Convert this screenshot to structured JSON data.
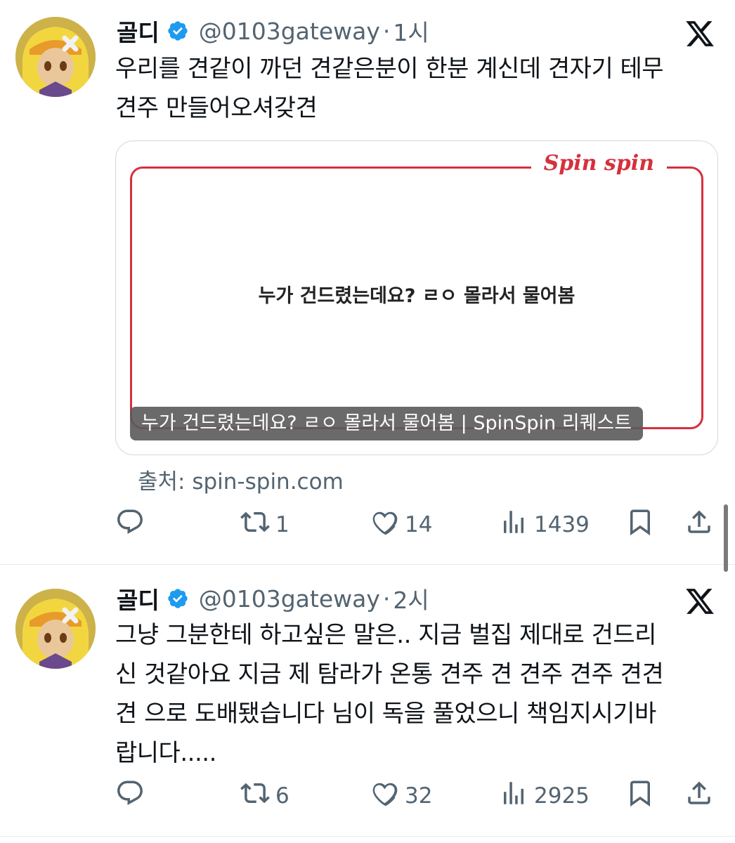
{
  "tweets": [
    {
      "name": "골디",
      "handle": "@0103gateway",
      "separator": "·",
      "time": "1시",
      "text": "우리를 견같이 까던 견같은분이 한분 계신데 견자기 테무\n견주 만들어오셔갖견",
      "card": {
        "brand": "Spin spin",
        "center_text": "누가 건드렸는데요? ㄹㅇ 몰라서 물어봄",
        "caption": "누가 건드렸는데요? ㄹㅇ 몰라서 물어봄 | SpinSpin 리퀘스트"
      },
      "source": "출처: spin-spin.com",
      "actions": {
        "reply": "",
        "retweet": "1",
        "like": "14",
        "views": "1439"
      }
    },
    {
      "name": "골디",
      "handle": "@0103gateway",
      "separator": "·",
      "time": "2시",
      "text": "그냥 그분한테 하고싶은 말은.. 지금 벌집 제대로 건드리\n신 것같아요 지금 제 탐라가 온통 견주 견 견주 견주 견견\n견 으로 도배됐습니다 님이 독을 풀었으니 책임지시기바\n랍니다.....",
      "actions": {
        "reply": "",
        "retweet": "6",
        "like": "32",
        "views": "2925"
      }
    }
  ],
  "colors": {
    "verified": "#1d9bf0",
    "brand_red": "#d6303d",
    "muted": "#536471"
  },
  "icons": [
    "verified-badge-icon",
    "x-logo-icon",
    "reply-icon",
    "retweet-icon",
    "like-icon",
    "views-icon",
    "bookmark-icon",
    "share-icon"
  ]
}
